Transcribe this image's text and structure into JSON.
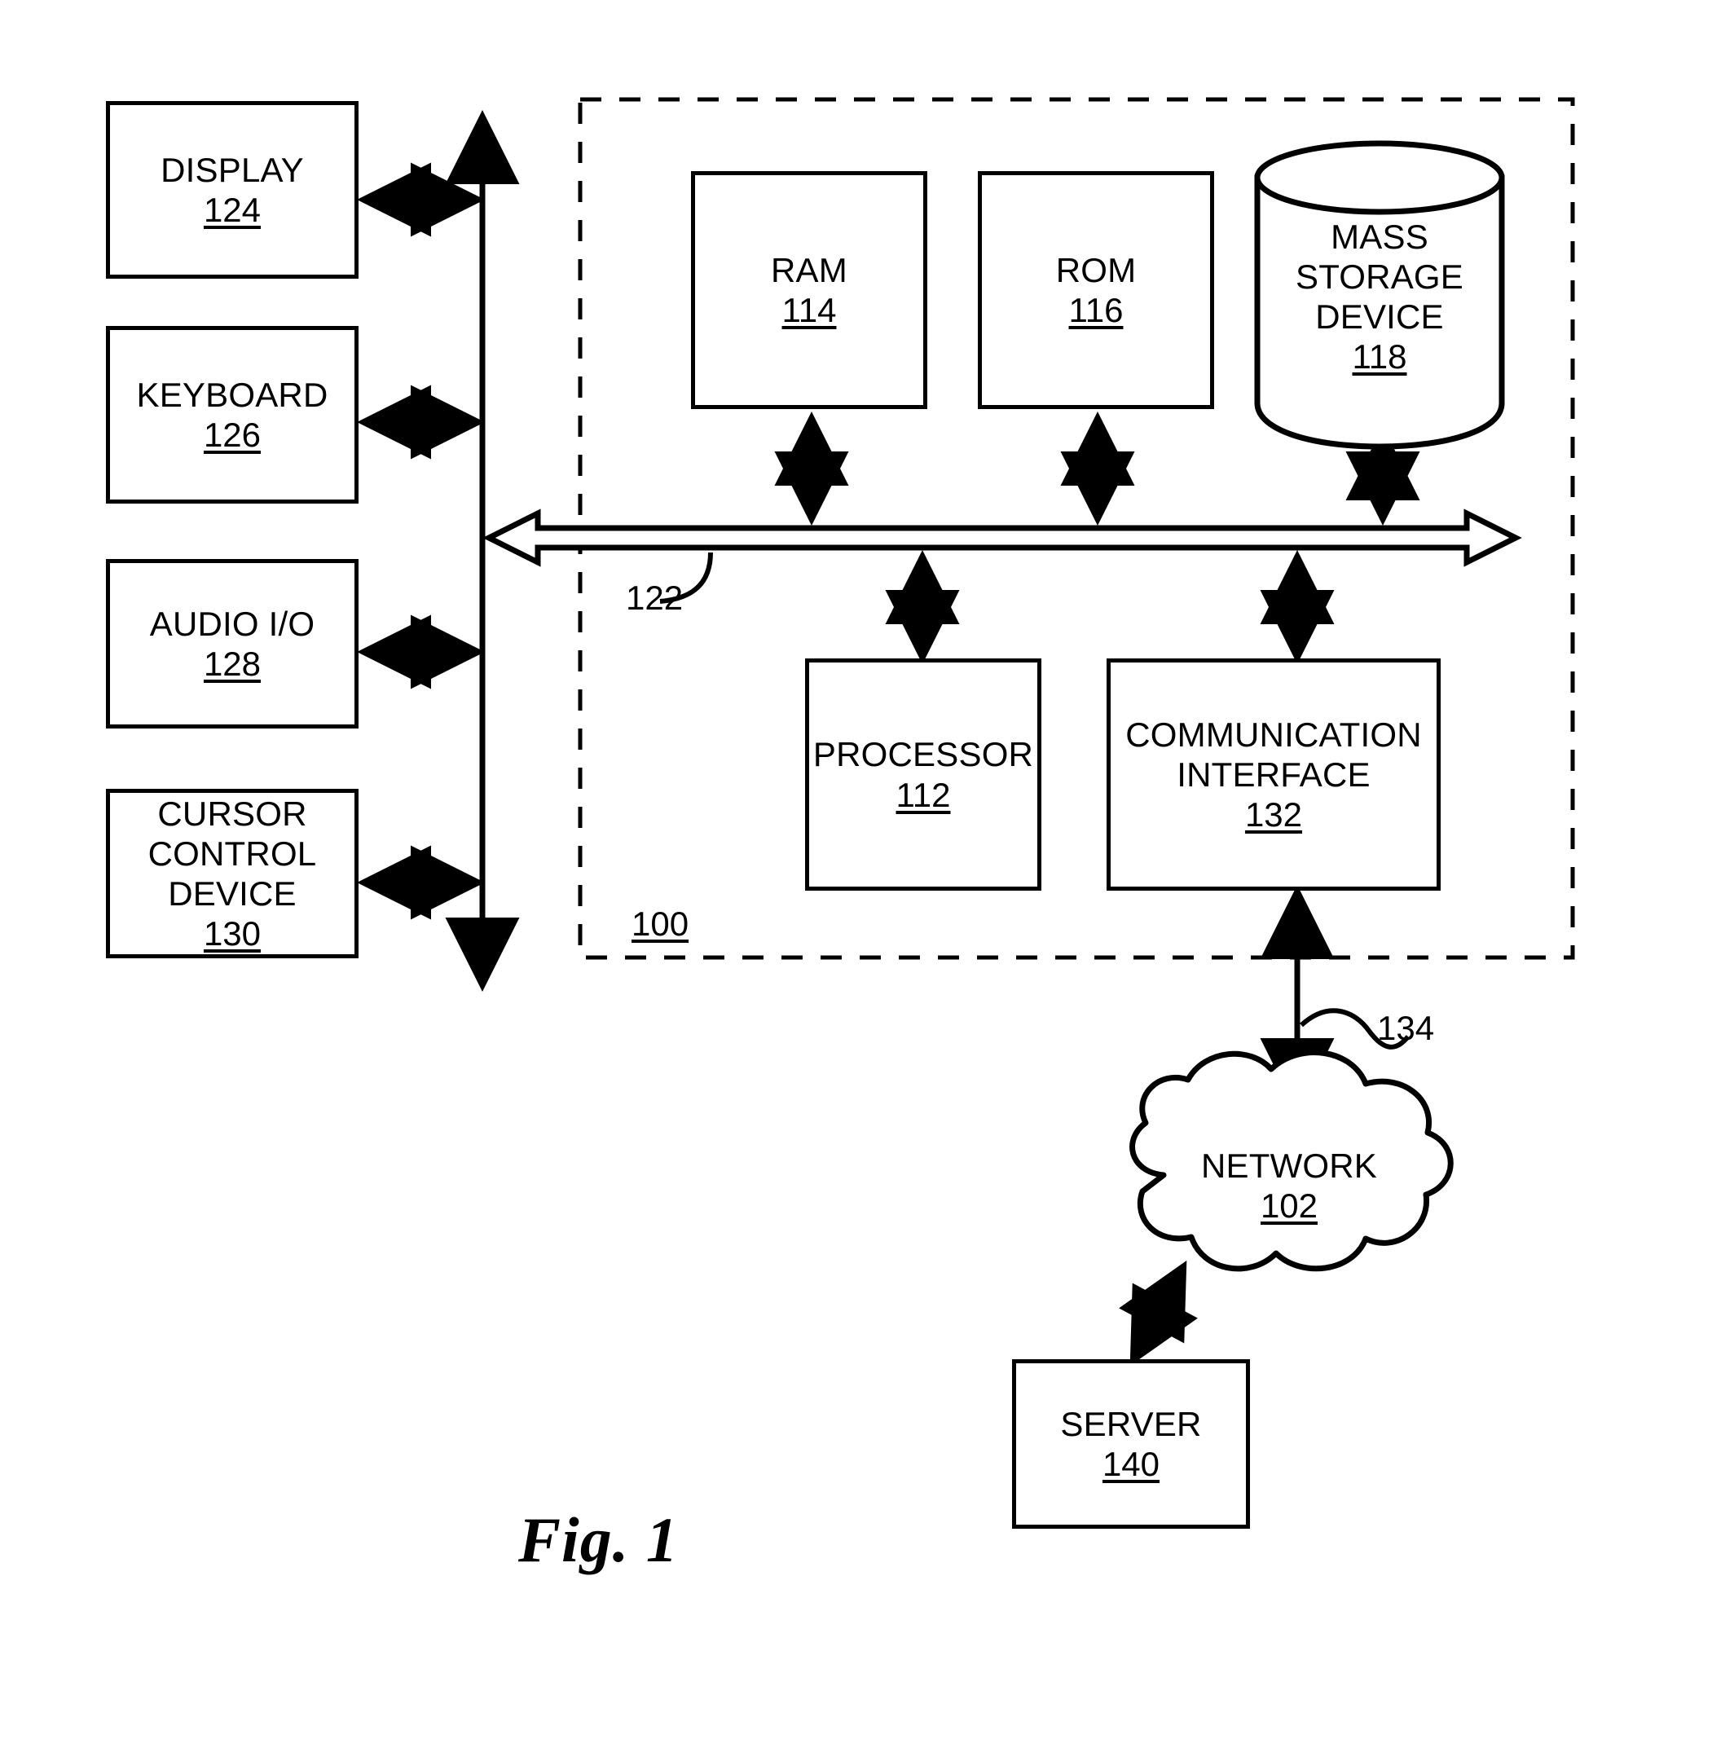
{
  "figure": {
    "caption": "Fig. 1",
    "system_ref": "100",
    "bus_ref": "122",
    "network_link_ref": "134"
  },
  "peripherals": [
    {
      "label": "DISPLAY",
      "ref": "124"
    },
    {
      "label": "KEYBOARD",
      "ref": "126"
    },
    {
      "label": "AUDIO I/O",
      "ref": "128"
    },
    {
      "label": "CURSOR\nCONTROL\nDEVICE",
      "ref": "130"
    }
  ],
  "memory": [
    {
      "label": "RAM",
      "ref": "114"
    },
    {
      "label": "ROM",
      "ref": "116"
    }
  ],
  "storage": {
    "label": "MASS\nSTORAGE\nDEVICE",
    "ref": "118"
  },
  "compute": [
    {
      "label": "PROCESSOR",
      "ref": "112"
    },
    {
      "label": "COMMUNICATION\nINTERFACE",
      "ref": "132"
    }
  ],
  "network": {
    "label": "NETWORK",
    "ref": "102"
  },
  "server": {
    "label": "SERVER",
    "ref": "140"
  },
  "colors": {
    "stroke": "#000000",
    "background": "#ffffff"
  }
}
